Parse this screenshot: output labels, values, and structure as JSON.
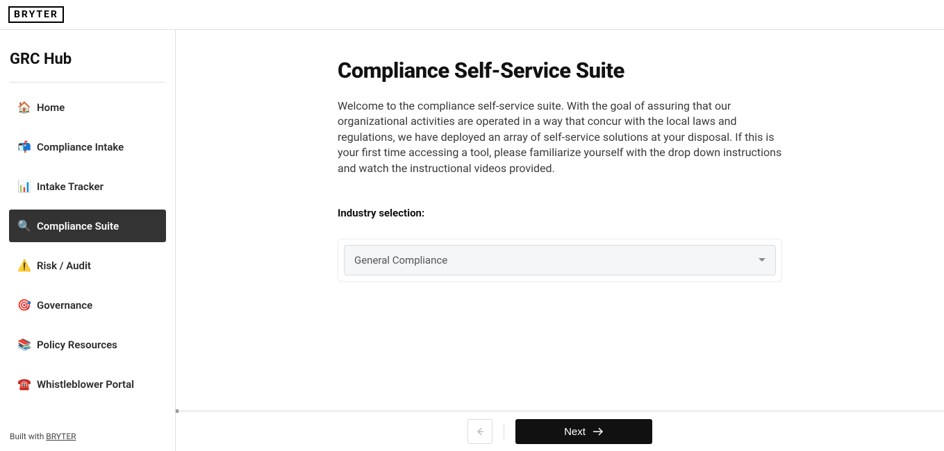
{
  "brand": "BRYTER",
  "sidebar": {
    "title": "GRC Hub",
    "items": [
      {
        "icon": "🏠",
        "label": "Home",
        "active": false
      },
      {
        "icon": "📬",
        "label": "Compliance Intake",
        "active": false
      },
      {
        "icon": "📊",
        "label": "Intake Tracker",
        "active": false
      },
      {
        "icon": "🔍",
        "label": "Compliance Suite",
        "active": true
      },
      {
        "icon": "⚠️",
        "label": "Risk / Audit",
        "active": false
      },
      {
        "icon": "🎯",
        "label": "Governance",
        "active": false
      },
      {
        "icon": "📚",
        "label": "Policy Resources",
        "active": false
      },
      {
        "icon": "☎️",
        "label": "Whistleblower Portal",
        "active": false
      }
    ],
    "footer_prefix": "Built with ",
    "footer_link": "BRYTER"
  },
  "page": {
    "title": "Compliance Self-Service Suite",
    "intro": "Welcome to the compliance self-service suite. With the goal of assuring that our organizational activities are operated in a way that concur with the local laws and regulations, we have deployed an array of self-service solutions at your disposal. If this is your first time accessing a tool, please familiarize yourself with the drop down instructions and watch the instructional videos provided.",
    "field_label": "Industry selection:",
    "select_value": "General Compliance"
  },
  "footer": {
    "next_label": "Next"
  }
}
